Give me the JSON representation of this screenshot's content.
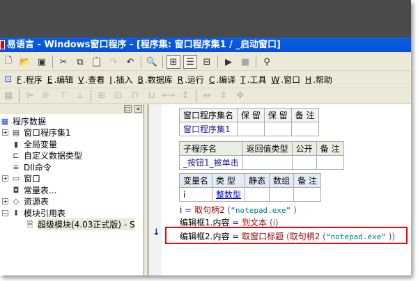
{
  "window": {
    "title": "易语言 - Windows窗口程序 - [程序集: 窗口程序集1 / _启动窗口]"
  },
  "toolbar": {
    "icons": [
      "new-file-icon",
      "open-folder-icon",
      "save-icon",
      "cut-icon",
      "copy-icon",
      "paste-icon",
      "redo-icon",
      "undo-icon",
      "find-icon",
      "layout1-icon",
      "layout2-icon",
      "layout3-icon",
      "run-icon",
      "stop-icon",
      "debug-binoculars-icon"
    ]
  },
  "menu": {
    "items": [
      {
        "key": "F",
        "label": "程序"
      },
      {
        "key": "E",
        "label": "编辑"
      },
      {
        "key": "V",
        "label": "查看"
      },
      {
        "key": "I",
        "label": "插入"
      },
      {
        "key": "B",
        "label": "数据库"
      },
      {
        "key": "R",
        "label": "运行"
      },
      {
        "key": "C",
        "label": "编译"
      },
      {
        "key": "T",
        "label": "工具"
      },
      {
        "key": "W",
        "label": "窗口"
      },
      {
        "key": "H",
        "label": "帮助"
      }
    ]
  },
  "tree": {
    "root": "程序数据",
    "items": [
      {
        "label": "窗口程序集1",
        "expander": "+",
        "icon": "▤"
      },
      {
        "label": "全局变量",
        "expander": "",
        "icon": "▮"
      },
      {
        "label": "自定义数据类型",
        "expander": "",
        "icon": "⊏"
      },
      {
        "label": "Dll命令",
        "expander": "",
        "icon": "≡"
      },
      {
        "label": "窗口",
        "expander": "+",
        "icon": "▭"
      },
      {
        "label": "常量表...",
        "expander": "",
        "icon": "◘"
      },
      {
        "label": "资源表",
        "expander": "+",
        "icon": "◇"
      },
      {
        "label": "模块引用表",
        "expander": "−",
        "icon": "⬇"
      }
    ],
    "child": "超级模块(4.03正式版) - S"
  },
  "editor": {
    "t1": {
      "headers": [
        "窗口程序集名",
        "保 留",
        "保 留",
        "备 注"
      ],
      "row": [
        "窗口程序集1",
        "",
        "",
        ""
      ]
    },
    "t2": {
      "headers": [
        "子程序名",
        "返回值类型",
        "公开",
        "备 注"
      ],
      "row": [
        "_按钮1_被单击",
        "",
        "",
        ""
      ]
    },
    "t3": {
      "headers": [
        "变量名",
        "类 型",
        "静态",
        "数组",
        "备 注"
      ],
      "row": [
        "i",
        "整数型",
        "",
        "",
        ""
      ]
    },
    "lines": [
      {
        "lhs": "i",
        "op": "=",
        "fn": "取句柄2",
        "open": " (",
        "str": "“notepad.exe”",
        "close": " )"
      },
      {
        "lhs": "编辑框1.内容",
        "op": "=",
        "fn": "到文本",
        "open": " (",
        "arg": "i",
        "close": ")"
      },
      {
        "lhs": "编辑框2.内容",
        "op": "=",
        "fn": "取窗口标题",
        "open": " (",
        "fn2": "取句柄2",
        "open2": " (",
        "str": "“notepad.exe”",
        "close": " ))"
      }
    ],
    "highlight_color": "#ff0000"
  }
}
